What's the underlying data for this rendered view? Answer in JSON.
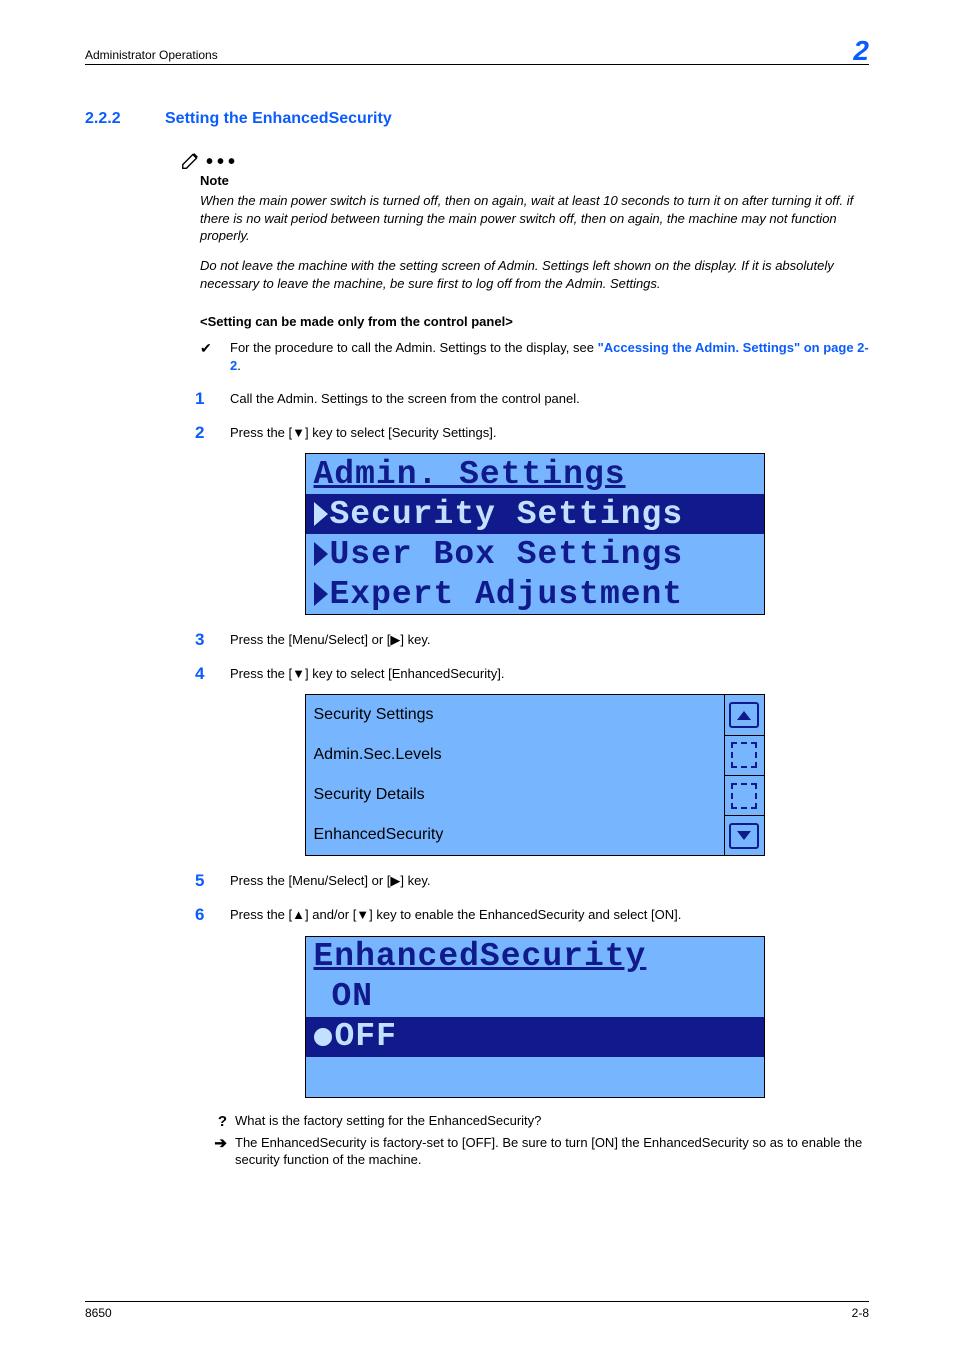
{
  "header": {
    "title": "Administrator Operations",
    "chapterNum": "2"
  },
  "section": {
    "num": "2.2.2",
    "title": "Setting the EnhancedSecurity"
  },
  "note": {
    "label": "Note",
    "p1": "When the main power switch is turned off, then on again, wait at least 10 seconds to turn it on after turning it off. if there is no wait period between turning the main power switch off, then on again, the machine may not function properly.",
    "p2": "Do not leave the machine with the setting screen of Admin. Settings left shown on the display. If it is absolutely necessary to leave the machine, be sure first to log off from the Admin. Settings."
  },
  "subhead": "<Setting can be made only from the control panel>",
  "proc": {
    "textA": "For the procedure to call the Admin. Settings to the display, see ",
    "link": "\"Accessing the Admin. Settings\" on page 2-2",
    "textB": "."
  },
  "steps": {
    "s1": "Call the Admin. Settings to the screen from the control panel.",
    "s2": "Press the [▼] key to select [Security Settings].",
    "s3": "Press the [Menu/Select] or [▶] key.",
    "s4": "Press the [▼] key to select [EnhancedSecurity].",
    "s5": "Press the [Menu/Select] or [▶] key.",
    "s6": "Press the [▲] and/or [▼] key to enable the EnhancedSecurity and select [ON]."
  },
  "lcd1": {
    "title": "Admin. Settings",
    "r1": "Security Settings",
    "r2": "User Box Settings",
    "r3": "Expert Adjustment"
  },
  "lcd2": {
    "title": "Security Settings",
    "r1": "Admin.Sec.Levels",
    "r2": "Security Details",
    "r3": "EnhancedSecurity"
  },
  "lcd3": {
    "title": "EnhancedSecurity",
    "r1": "ON",
    "r2": "OFF"
  },
  "qa": {
    "q": "What is the factory setting for the EnhancedSecurity?",
    "a": "The EnhancedSecurity is factory-set to [OFF]. Be sure to turn [ON] the EnhancedSecurity so as to enable the security function of the machine."
  },
  "footer": {
    "left": "8650",
    "right": "2-8"
  }
}
